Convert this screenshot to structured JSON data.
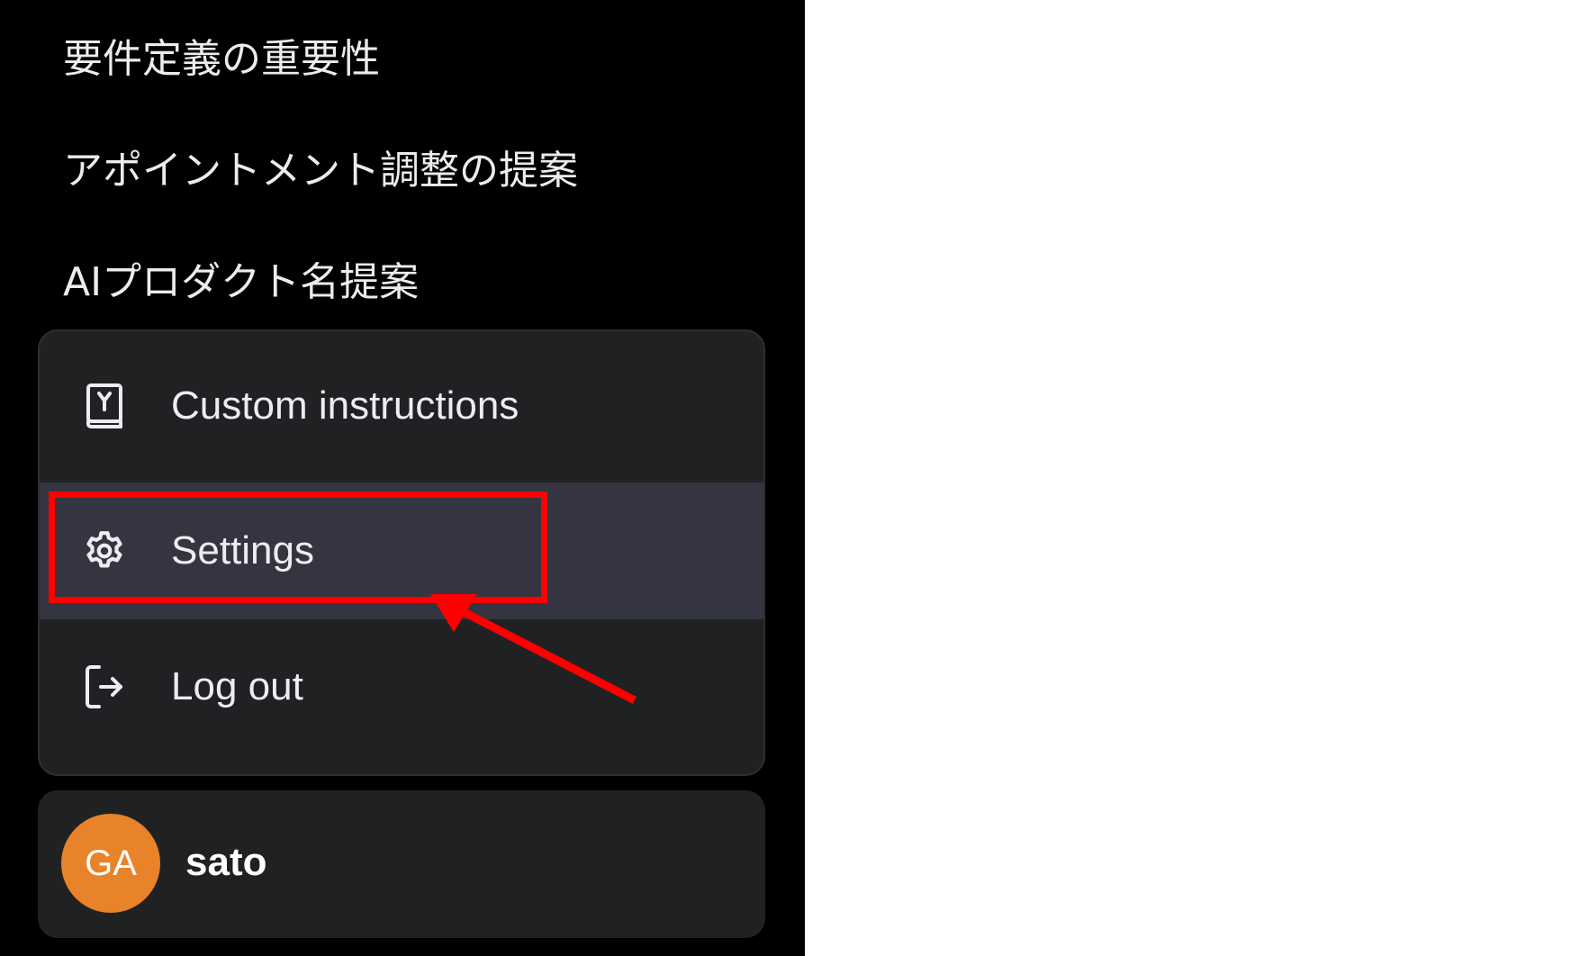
{
  "sidebar": {
    "chats": [
      {
        "title": "要件定義の重要性"
      },
      {
        "title": "アポイントメント調整の提案"
      },
      {
        "title": "AIプロダクト名提案"
      }
    ]
  },
  "user_menu": {
    "items": [
      {
        "label": "Custom instructions",
        "icon": "custom-instructions-icon"
      },
      {
        "label": "Settings",
        "icon": "gear-icon",
        "highlighted": true
      },
      {
        "label": "Log out",
        "icon": "logout-icon"
      }
    ]
  },
  "user": {
    "avatar_initials": "GA",
    "name": "sato",
    "avatar_color": "#e8832a"
  },
  "annotation": {
    "highlight_color": "#ff0000",
    "target": "Settings"
  },
  "colors": {
    "sidebar_bg": "#000000",
    "menu_bg": "#202123",
    "menu_hover_bg": "#343541",
    "page_bg": "#ffffff"
  }
}
